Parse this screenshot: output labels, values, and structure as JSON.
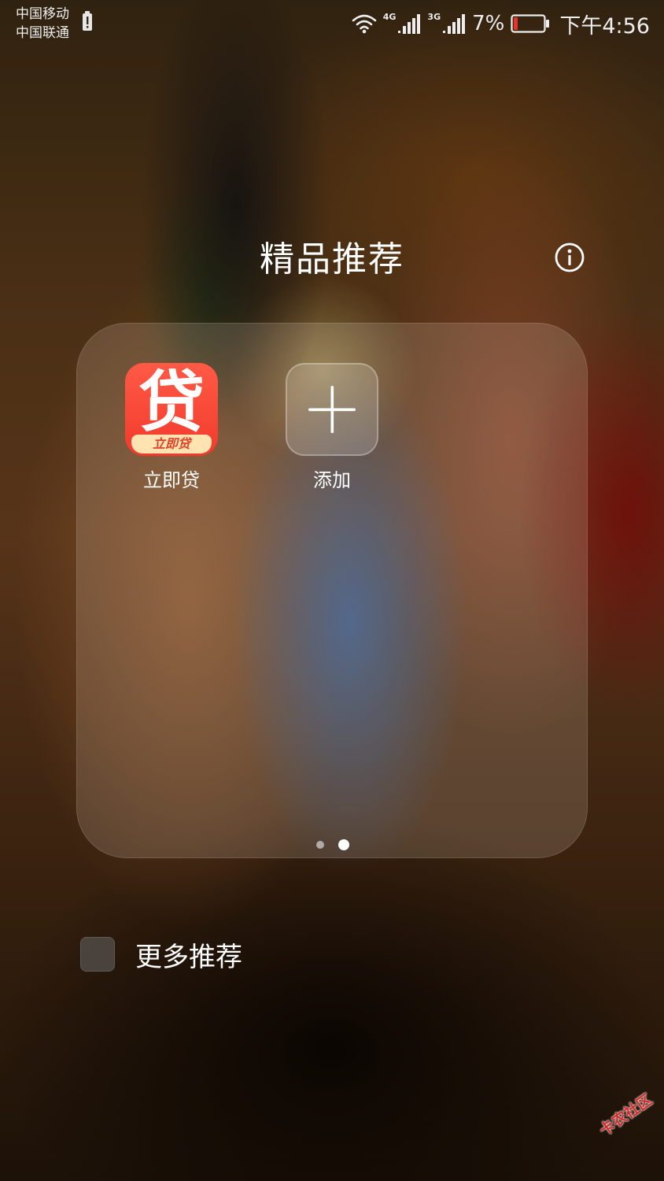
{
  "status_bar": {
    "carrier_1": "中国移动",
    "carrier_2": "中国联通",
    "network_1": "4G",
    "network_2": "3G",
    "battery_percent": "7%",
    "time": "下午4:56",
    "battery_level": 0.07,
    "battery_low_color": "#e8332a",
    "icons": [
      "sim-alert-icon",
      "wifi-icon",
      "signal-icon",
      "signal-icon",
      "battery-icon"
    ]
  },
  "header": {
    "title": "精品推荐",
    "info_icon": "info-icon"
  },
  "folder": {
    "apps": [
      {
        "label": "立即贷",
        "icon_char": "贷",
        "icon_ribbon": "立即贷",
        "icon_colors": [
          "#ff5a46",
          "#ffe3b0"
        ]
      },
      {
        "label": "添加",
        "icon": "plus-icon"
      }
    ],
    "pages": 2,
    "current_page": 2
  },
  "more": {
    "label": "更多推荐",
    "checked": false
  },
  "watermark": {
    "text": "卡农社区"
  }
}
